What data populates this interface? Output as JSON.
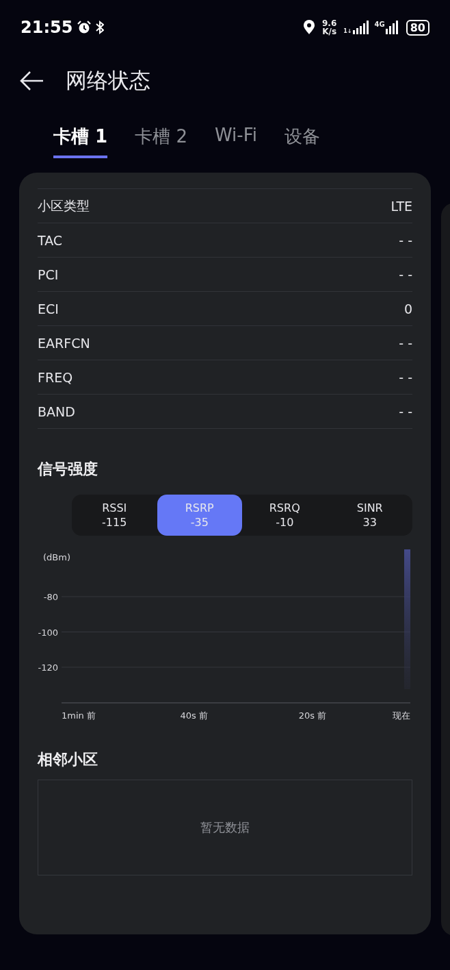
{
  "status_bar": {
    "time": "21:55",
    "speed_value": "9.6",
    "speed_unit": "K/s",
    "signal_tag": "1↓",
    "network": "4G",
    "battery": "80"
  },
  "header": {
    "title": "网络状态"
  },
  "tabs": [
    {
      "label": "卡槽 1",
      "selected": true
    },
    {
      "label": "卡槽 2",
      "selected": false
    },
    {
      "label": "Wi-Fi",
      "selected": false
    },
    {
      "label": "设备",
      "selected": false
    }
  ],
  "info_rows": [
    {
      "label": "小区类型",
      "value": "LTE"
    },
    {
      "label": "TAC",
      "value": "- -"
    },
    {
      "label": "PCI",
      "value": "- -"
    },
    {
      "label": "ECI",
      "value": "0"
    },
    {
      "label": "EARFCN",
      "value": "- -"
    },
    {
      "label": "FREQ",
      "value": "- -"
    },
    {
      "label": "BAND",
      "value": "- -"
    }
  ],
  "signal": {
    "title": "信号强度",
    "metrics": [
      {
        "name": "RSSI",
        "value": "-115",
        "selected": false
      },
      {
        "name": "RSRP",
        "value": "-35",
        "selected": true
      },
      {
        "name": "RSRQ",
        "value": "-10",
        "selected": false
      },
      {
        "name": "SINR",
        "value": "33",
        "selected": false
      }
    ],
    "graph": {
      "unit": "(dBm)",
      "y_labels": [
        "-80",
        "-100",
        "-120"
      ],
      "x_labels": [
        "1min 前",
        "40s 前",
        "20s 前",
        "现在"
      ]
    }
  },
  "neighbors": {
    "title": "相邻小区",
    "empty_text": "暂无数据"
  }
}
